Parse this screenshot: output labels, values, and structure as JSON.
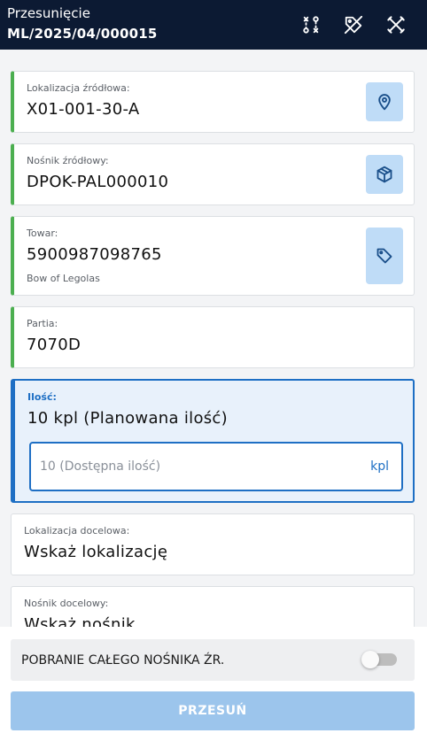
{
  "header": {
    "title": "Przesunięcie",
    "document_number": "ML/2025/04/000015",
    "icons": [
      "route-icon",
      "tag-off-icon",
      "tools-icon"
    ]
  },
  "fields": {
    "source_location": {
      "label": "Lokalizacja źródłowa:",
      "value": "X01-001-30-A",
      "icon": "location-pin-icon"
    },
    "source_carrier": {
      "label": "Nośnik źródłowy:",
      "value": "DPOK-PAL000010",
      "icon": "box-icon"
    },
    "item": {
      "label": "Towar:",
      "value": "5900987098765",
      "description": "Bow of Legolas",
      "icon": "tag-icon"
    },
    "batch": {
      "label": "Partia:",
      "value": "7070D"
    },
    "quantity": {
      "label": "Ilość:",
      "value": "10 kpl (Planowana ilość)",
      "input_placeholder": "10 (Dostępna ilość)",
      "unit": "kpl"
    },
    "target_location": {
      "label": "Lokalizacja docelowa:",
      "value": "Wskaż lokalizację"
    },
    "target_carrier": {
      "label": "Nośnik docelowy:",
      "value": "Wskaż nośnik"
    }
  },
  "footer": {
    "toggle_label": "POBRANIE CAŁEGO NOŚNIKA ŹR.",
    "toggle_on": false,
    "submit_label": "PRZESUŃ"
  },
  "colors": {
    "header_bg": "#0c1a33",
    "accent": "#1e6fc4",
    "ok_border": "#4caf50",
    "icon_button_bg": "#bfdcf7",
    "submit_bg": "#9cc5ec"
  }
}
